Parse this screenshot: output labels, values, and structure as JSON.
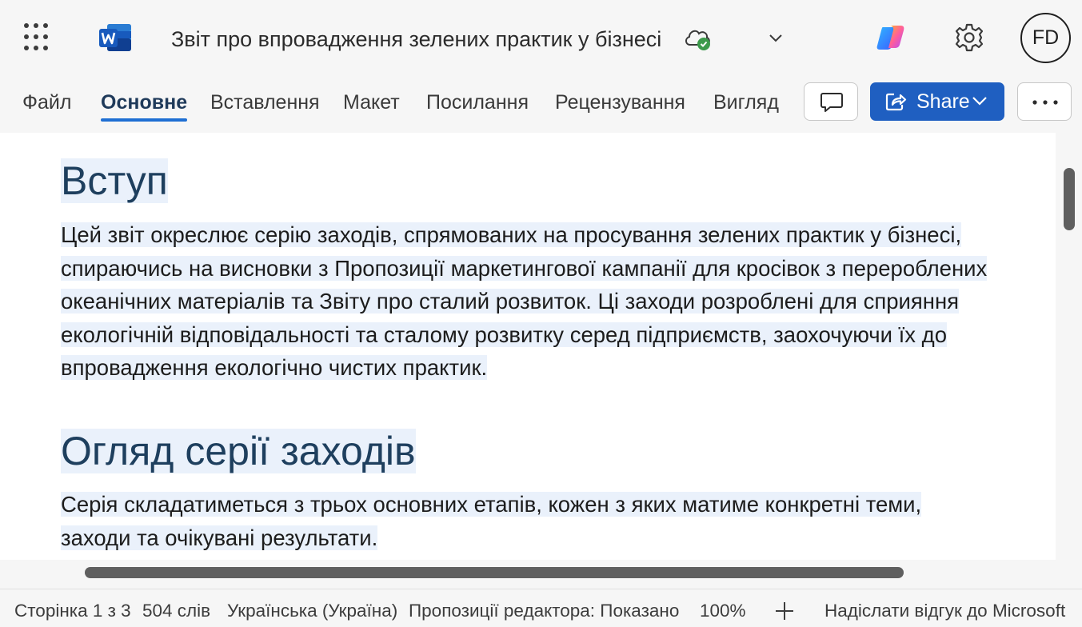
{
  "app": {
    "doc_title": "Звіт про впровадження зелених практик у бізнесі",
    "avatar_initials": "FD",
    "accent_color": "#1f5fc1",
    "icons": [
      "app-launcher-icon",
      "word-logo-icon",
      "cloud-saved-icon",
      "chevron-down-icon",
      "copilot-icon",
      "gear-icon"
    ]
  },
  "ribbon": {
    "tabs": [
      {
        "label": "Файл",
        "active": false
      },
      {
        "label": "Основне",
        "active": true
      },
      {
        "label": "Вставлення",
        "active": false
      },
      {
        "label": "Макет",
        "active": false
      },
      {
        "label": "Посилання",
        "active": false
      },
      {
        "label": "Рецензування",
        "active": false
      },
      {
        "label": "Вигляд",
        "active": false
      }
    ],
    "share_label": "Share"
  },
  "document": {
    "heading1": "Вступ",
    "para1_lines": [
      "Цей звіт окреслює серію заходів, спрямованих на просування зелених практик у бізнесі,",
      "спираючись на висновки з Пропозиції маркетингової кампанії для кросівок з перероблених",
      "океанічних матеріалів та Звіту про сталий розвиток. Ці заходи розроблені для сприяння",
      "екологічній відповідальності та сталому розвитку серед підприємств, заохочуючи їх до",
      "впровадження екологічно чистих практик."
    ],
    "heading2": "Огляд серії заходів",
    "para2_lines": [
      "Серія складатиметься з трьох основних етапів, кожен з яких матиме конкретні теми,",
      "заходи та очікувані результати."
    ]
  },
  "status": {
    "page": "Сторінка 1 з 3",
    "words": "504 слів",
    "language": "Українська (Україна)",
    "editor": "Пропозиції редактора: Показано",
    "zoom": "100%",
    "feedback": "Надіслати відгук до Microsoft"
  }
}
